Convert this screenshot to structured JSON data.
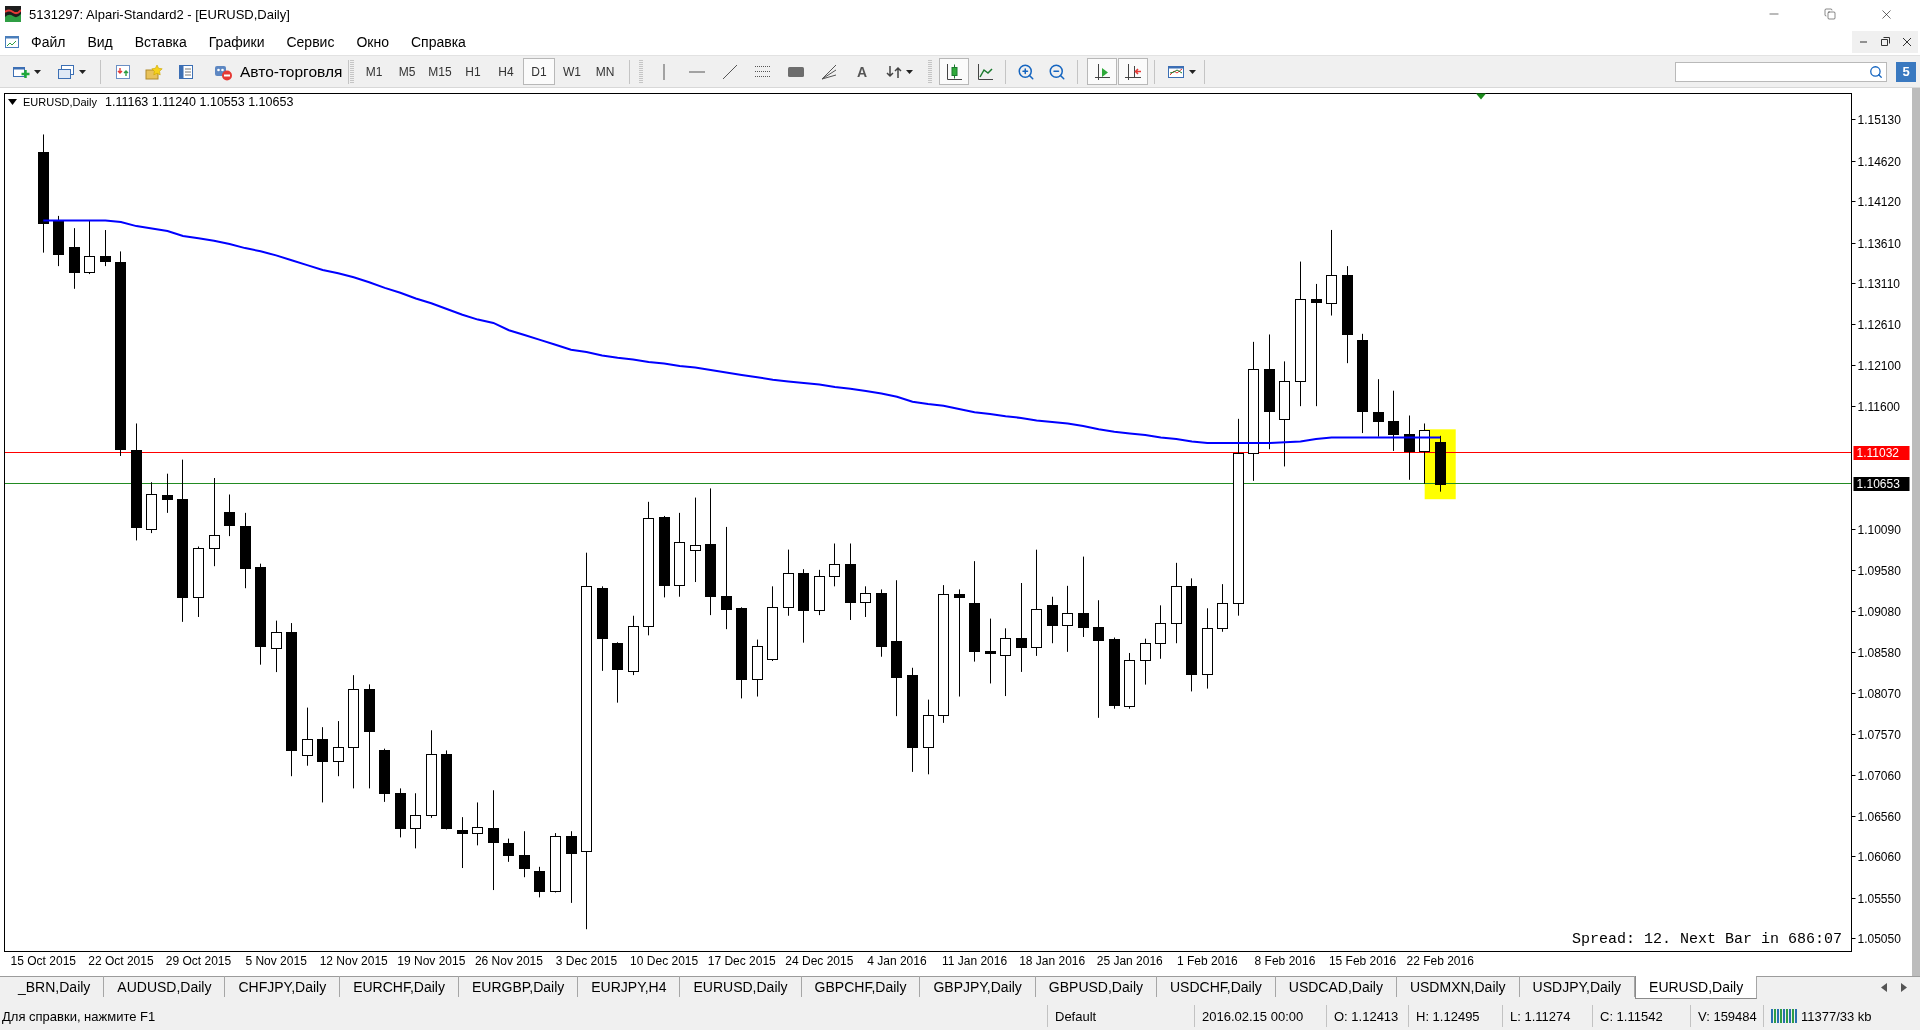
{
  "window": {
    "title": "5131297: Alpari-Standard2 - [EURUSD,Daily]"
  },
  "menu": [
    "Файл",
    "Вид",
    "Вставка",
    "Графики",
    "Сервис",
    "Окно",
    "Справка"
  ],
  "toolbar": {
    "autotrading_label": "Авто-торговля",
    "timeframes": [
      {
        "label": "M1",
        "selected": false
      },
      {
        "label": "M5",
        "selected": false
      },
      {
        "label": "M15",
        "selected": false
      },
      {
        "label": "H1",
        "selected": false
      },
      {
        "label": "H4",
        "selected": false
      },
      {
        "label": "D1",
        "selected": true
      },
      {
        "label": "W1",
        "selected": false
      },
      {
        "label": "MN",
        "selected": false
      }
    ],
    "text_tool": "A",
    "chart_types": [
      {
        "kind": "candles",
        "selected": true
      },
      {
        "kind": "line",
        "selected": false
      }
    ],
    "view_toggles": [
      {
        "kind": "auto_scroll",
        "selected": true
      },
      {
        "kind": "chart_shift",
        "selected": true
      }
    ],
    "community": "5"
  },
  "chart": {
    "symbol": "EURUSD,Daily",
    "ohlc": "1.11163 1.11240 1.10553 1.10653",
    "info": "Spread: 12. Next Bar in 686:07",
    "price_tags": [
      {
        "color": "#ff0000"
      },
      {
        "color": "#000000"
      }
    ],
    "chart_data": [
      {
        "type": "candlestick",
        "categories": [
          null,
          null,
          "15 Oct 2015",
          null,
          null,
          null,
          null,
          "22 Oct 2015",
          null,
          null,
          null,
          null,
          "29 Oct 2015",
          null,
          null,
          null,
          null,
          "5 Nov 2015",
          null,
          null,
          null,
          null,
          "12 Nov 2015",
          null,
          null,
          null,
          null,
          "19 Nov 2015",
          null,
          null,
          null,
          null,
          "26 Nov 2015",
          null,
          null,
          null,
          null,
          "3 Dec 2015",
          null,
          null,
          null,
          null,
          "10 Dec 2015",
          null,
          null,
          null,
          null,
          "17 Dec 2015",
          null,
          null,
          null,
          null,
          "24 Dec 2015",
          null,
          null,
          null,
          null,
          "4 Jan 2016",
          null,
          null,
          null,
          null,
          "11 Jan 2016",
          null,
          null,
          null,
          null,
          "18 Jan 2016",
          null,
          null,
          null,
          null,
          "25 Jan 2016",
          null,
          null,
          null,
          null,
          "1 Feb 2016",
          null,
          null,
          null,
          null,
          "8 Feb 2016",
          null,
          null,
          null,
          null,
          "15 Feb 2016",
          null,
          null,
          null,
          null,
          "22 Feb 2016",
          null,
          null,
          null,
          null,
          null,
          null,
          null,
          null,
          null,
          null,
          null,
          null,
          null,
          null,
          null,
          null,
          null,
          null,
          null,
          null,
          null,
          null,
          null,
          null,
          null,
          null
        ],
        "series": [
          {
            "type": "candlestick",
            "ohlc": [
              null,
              null,
              [
                1.14737,
                1.14948,
                1.13494,
                1.1386
              ],
              [
                1.13893,
                1.13946,
                1.13328,
                1.13479
              ],
              [
                1.13569,
                1.13795,
                1.13049,
                1.1326
              ],
              [
                1.13253,
                1.13885,
                1.1323,
                1.13448
              ],
              [
                1.13456,
                1.13772,
                1.13328,
                1.13388
              ],
              [
                1.13381,
                1.13509,
                1.10992,
                1.11083
              ],
              [
                1.11068,
                1.11392,
                1.09953,
                1.10119
              ],
              [
                1.10088,
                1.10669,
                1.10043,
                1.10525
              ],
              [
                1.10518,
                1.10774,
                1.10292,
                1.10458
              ],
              [
                1.10458,
                1.10947,
                1.08951,
                1.0926
              ],
              [
                1.0926,
                1.09878,
                1.09011,
                1.09855
              ],
              [
                1.09855,
                1.10721,
                1.09636,
                1.10021
              ],
              [
                1.10307,
                1.10518,
                1.10006,
                1.10141
              ],
              [
                1.10134,
                1.10292,
                1.09365,
                1.09614
              ],
              [
                1.09621,
                1.09667,
                1.08424,
                1.0865
              ],
              [
                1.08634,
                1.08966,
                1.08333,
                1.08823
              ],
              [
                1.0883,
                1.08936,
                1.07052,
                1.07369
              ],
              [
                1.07316,
                1.07896,
                1.07181,
                1.07505
              ],
              [
                1.07505,
                1.07655,
                1.06729,
                1.07233
              ],
              [
                1.07233,
                1.0773,
                1.07052,
                1.07414
              ],
              [
                1.07406,
                1.08295,
                1.06902,
                1.08122
              ],
              [
                1.08122,
                1.08182,
                1.06902,
                1.0761
              ],
              [
                1.07376,
                1.07391,
                1.06736,
                1.06849
              ],
              [
                1.06849,
                1.06902,
                1.06299,
                1.06412
              ],
              [
                1.06412,
                1.06842,
                1.06164,
                1.06578
              ],
              [
                1.06578,
                1.07617,
                1.0654,
                1.07331
              ],
              [
                1.07323,
                1.07369,
                1.06397,
                1.06412
              ],
              [
                1.0639,
                1.06548,
                1.05922,
                1.06359
              ],
              [
                1.06352,
                1.06729,
                1.06201,
                1.06427
              ],
              [
                1.0642,
                1.06879,
                1.05651,
                1.06239
              ],
              [
                1.06224,
                1.06284,
                1.05998,
                1.06088
              ],
              [
                1.06088,
                1.06375,
                1.05809,
                1.05922
              ],
              [
                1.05885,
                1.05937,
                1.05561,
                1.05636
              ],
              [
                1.05636,
                1.06352,
                1.05621,
                1.06314
              ],
              [
                1.06314,
                1.06375,
                1.05493,
                1.06111
              ],
              [
                1.06126,
                1.09802,
                1.05169,
                1.09388
              ],
              [
                1.09373,
                1.09388,
                1.08348,
                1.08747
              ],
              [
                1.08687,
                1.087,
                1.07957,
                1.08371
              ],
              [
                1.08348,
                1.09026,
                1.08296,
                1.08898
              ],
              [
                1.08898,
                1.10428,
                1.08785,
                1.10232
              ],
              [
                1.10239,
                1.10254,
                1.09252,
                1.09403
              ],
              [
                1.09403,
                1.10292,
                1.0926,
                1.09938
              ],
              [
                1.0984,
                1.1048,
                1.09441,
                1.099
              ],
              [
                1.09915,
                1.10593,
                1.09034,
                1.09275
              ],
              [
                1.09275,
                1.10119,
                1.08861,
                1.09109
              ],
              [
                1.09124,
                1.0913,
                1.08009,
                1.08243
              ],
              [
                1.08243,
                1.08733,
                1.08032,
                1.0865
              ],
              [
                1.08499,
                1.09388,
                1.08469,
                1.09139
              ],
              [
                1.09139,
                1.0984,
                1.09026,
                1.09554
              ],
              [
                1.09554,
                1.09599,
                1.08695,
                1.09102
              ],
              [
                1.09102,
                1.09591,
                1.09034,
                1.09516
              ],
              [
                1.09516,
                1.09915,
                1.09388,
                1.09667
              ],
              [
                1.09667,
                1.09915,
                1.08974,
                1.09192
              ],
              [
                1.09192,
                1.09388,
                1.09011,
                1.09312
              ],
              [
                1.09312,
                1.0935,
                1.08522,
                1.0865
              ],
              [
                1.0871,
                1.09463,
                1.07791,
                1.08273
              ],
              [
                1.08296,
                1.08386,
                1.07105,
                1.07406
              ],
              [
                1.07406,
                1.07994,
                1.07075,
                1.07806
              ],
              [
                1.07806,
                1.09403,
                1.07708,
                1.0929
              ],
              [
                1.0929,
                1.0935,
                1.08032,
                1.0926
              ],
              [
                1.09189,
                1.09698,
                1.08462,
                1.08589
              ],
              [
                1.08589,
                1.08991,
                1.08193,
                1.08568
              ],
              [
                1.08547,
                1.08871,
                1.08038,
                1.08758
              ],
              [
                1.08758,
                1.09429,
                1.08335,
                1.08638
              ],
              [
                1.08638,
                1.09839,
                1.08532,
                1.09111
              ],
              [
                1.09161,
                1.0926,
                1.08688,
                1.08907
              ],
              [
                1.08907,
                1.09394,
                1.08582,
                1.09062
              ],
              [
                1.09062,
                1.09754,
                1.08765,
                1.08885
              ],
              [
                1.08885,
                1.09217,
                1.0777,
                1.0873
              ],
              [
                1.08737,
                1.08758,
                1.07882,
                1.07932
              ],
              [
                1.07911,
                1.08568,
                1.07882,
                1.08476
              ],
              [
                1.08476,
                1.08744,
                1.08179,
                1.08688
              ],
              [
                1.08688,
                1.09154,
                1.08497,
                1.08935
              ],
              [
                1.08935,
                1.09677,
                1.08688,
                1.09394
              ],
              [
                1.09394,
                1.09486,
                1.08095,
                1.08306
              ],
              [
                1.08306,
                1.09118,
                1.0813,
                1.08871
              ],
              [
                1.08871,
                1.09415,
                1.08829,
                1.09182
              ],
              [
                1.09182,
                1.11449,
                1.09027,
                1.11025
              ],
              [
                1.11025,
                1.12396,
                1.10686,
                1.12064
              ],
              [
                1.12064,
                1.12487,
                1.11075,
                1.11548
              ],
              [
                1.11442,
                1.12156,
                1.10863,
                1.11915
              ],
              [
                1.11915,
                1.13384,
                1.11605,
                1.12925
              ],
              [
                1.12918,
                1.13109,
                1.11605,
                1.1289
              ],
              [
                1.12876,
                1.13773,
                1.1272,
                1.13222
              ],
              [
                1.13222,
                1.13328,
                1.12134,
                1.12494
              ],
              [
                1.12413,
                1.12495,
                1.11274,
                1.11542
              ],
              [
                1.11534,
                1.11937,
                1.1123,
                1.11428
              ],
              [
                1.11428,
                1.11795,
                1.11054,
                1.11265
              ],
              [
                1.11265,
                1.1149,
                1.10699,
                1.11051
              ],
              [
                1.11051,
                1.11392,
                1.1065,
                1.11315
              ],
              [
                1.11163,
                1.1124,
                1.10553,
                1.10653
              ],
              null,
              null,
              null,
              null,
              null,
              null,
              null,
              null,
              null,
              null,
              null,
              null,
              null,
              null,
              null,
              null,
              null,
              null,
              null,
              null,
              null,
              null,
              null,
              null,
              null,
              null
            ]
          },
          {
            "type": "line",
            "color": "#0000ff",
            "values": [
              null,
              null,
              1.1389,
              1.1389,
              1.1389,
              1.1389,
              1.1389,
              1.1387,
              1.1382,
              1.1379,
              1.1376,
              1.137,
              1.1367,
              1.1364,
              1.136,
              1.1355,
              1.1351,
              1.1346,
              1.134,
              1.1334,
              1.1328,
              1.1324,
              1.1319,
              1.1313,
              1.1306,
              1.13,
              1.1293,
              1.1287,
              1.128,
              1.1273,
              1.1267,
              1.1263,
              1.1254,
              1.1248,
              1.1242,
              1.1236,
              1.123,
              1.1227,
              1.1223,
              1.122,
              1.1218,
              1.1215,
              1.1213,
              1.121,
              1.1208,
              1.1205,
              1.1202,
              1.1199,
              1.1196,
              1.1193,
              1.1191,
              1.1189,
              1.1187,
              1.1184,
              1.1182,
              1.1179,
              1.1176,
              1.1172,
              1.1166,
              1.1163,
              1.1161,
              1.1157,
              1.1153,
              1.1151,
              1.1148,
              1.1146,
              1.1143,
              1.1141,
              1.1139,
              1.1136,
              1.1132,
              1.1129,
              1.1127,
              1.1125,
              1.1122,
              1.112,
              1.1117,
              1.1115,
              1.1115,
              1.1115,
              1.1115,
              1.1115,
              1.1116,
              1.1117,
              1.112,
              1.1122,
              1.1122,
              1.1122,
              1.1122,
              1.1122,
              1.1122,
              1.1122,
              1.1122,
              null,
              null,
              null,
              null,
              null,
              null,
              null,
              null,
              null,
              null,
              null,
              null,
              null,
              null,
              null,
              null,
              null,
              null,
              null,
              null,
              null,
              null,
              null,
              null,
              null,
              null
            ]
          }
        ],
        "ylim": [
          1.04895,
          1.15452
        ],
        "yticks": [
          {
            "value": 1.1513,
            "label": "1.15130"
          },
          {
            "value": 1.1462,
            "label": "1.14620"
          },
          {
            "value": 1.1412,
            "label": "1.14120"
          },
          {
            "value": 1.1361,
            "label": "1.13610"
          },
          {
            "value": 1.1311,
            "label": "1.13110"
          },
          {
            "value": 1.1261,
            "label": "1.12610"
          },
          {
            "value": 1.121,
            "label": "1.12100"
          },
          {
            "value": 1.116,
            "label": "1.11600"
          },
          {
            "value": 1.1009,
            "label": "1.10090"
          },
          {
            "value": 1.0958,
            "label": "1.09580"
          },
          {
            "value": 1.0908,
            "label": "1.09080"
          },
          {
            "value": 1.0858,
            "label": "1.08580"
          },
          {
            "value": 1.0807,
            "label": "1.08070"
          },
          {
            "value": 1.0757,
            "label": "1.07570"
          },
          {
            "value": 1.0706,
            "label": "1.07060"
          },
          {
            "value": 1.0656,
            "label": "1.06560"
          },
          {
            "value": 1.0606,
            "label": "1.06060"
          },
          {
            "value": 1.0555,
            "label": "1.05550"
          },
          {
            "value": 1.0505,
            "label": "1.05050"
          }
        ],
        "ref_lines": [
          {
            "axis": "y",
            "value": 1.11032,
            "label": "1.11032",
            "color": "#ff0000"
          },
          {
            "axis": "y",
            "value": 1.10653,
            "label": "1.10653",
            "color": "#228b22"
          }
        ]
      }
    ]
  },
  "tabs": [
    {
      "label": "_BRN,Daily",
      "selected": false
    },
    {
      "label": "AUDUSD,Daily",
      "selected": false
    },
    {
      "label": "CHFJPY,Daily",
      "selected": false
    },
    {
      "label": "EURCHF,Daily",
      "selected": false
    },
    {
      "label": "EURGBP,Daily",
      "selected": false
    },
    {
      "label": "EURJPY,H4",
      "selected": false
    },
    {
      "label": "EURUSD,Daily",
      "selected": false
    },
    {
      "label": "GBPCHF,Daily",
      "selected": false
    },
    {
      "label": "GBPJPY,Daily",
      "selected": false
    },
    {
      "label": "GBPUSD,Daily",
      "selected": false
    },
    {
      "label": "USDCHF,Daily",
      "selected": false
    },
    {
      "label": "USDCAD,Daily",
      "selected": false
    },
    {
      "label": "USDMXN,Daily",
      "selected": false
    },
    {
      "label": "USDJPY,Daily",
      "selected": false
    },
    {
      "label": "EURUSD,Daily",
      "selected": true
    }
  ],
  "status_bar": {
    "help": "Для справки, нажмите F1",
    "profile": "Default",
    "time": "2016.02.15 00:00",
    "open": "O: 1.12413",
    "high": "H: 1.12495",
    "low": "L: 1.11274",
    "close": "C: 1.11542",
    "volume": "V: 159484",
    "traffic": "11377/33 kb"
  }
}
